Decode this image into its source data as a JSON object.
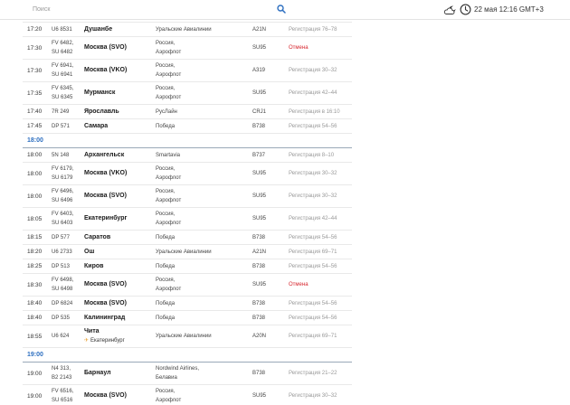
{
  "search": {
    "placeholder": "Поиск"
  },
  "header": {
    "datetime": "22 мая 12:16 GMT+3"
  },
  "board": [
    {
      "type": "flight",
      "time": "17:20",
      "flights": [
        "U6 8531"
      ],
      "dest": "Душанбе",
      "airline": [
        "Уральские Авиалинии"
      ],
      "aircraft": "A21N",
      "status": "Регистрация 76–78",
      "cancelled": false
    },
    {
      "type": "flight",
      "time": "17:30",
      "flights": [
        "FV 6482,",
        "SU 6482"
      ],
      "dest": "Москва (SVO)",
      "airline": [
        "Россия,",
        "Аэрофлот"
      ],
      "aircraft": "SU95",
      "status": "Отмена",
      "cancelled": true
    },
    {
      "type": "flight",
      "time": "17:30",
      "flights": [
        "FV 6941,",
        "SU 6941"
      ],
      "dest": "Москва (VKO)",
      "airline": [
        "Россия,",
        "Аэрофлот"
      ],
      "aircraft": "A319",
      "status": "Регистрация 30–32",
      "cancelled": false
    },
    {
      "type": "flight",
      "time": "17:35",
      "flights": [
        "FV 6345,",
        "SU 6345"
      ],
      "dest": "Мурманск",
      "airline": [
        "Россия,",
        "Аэрофлот"
      ],
      "aircraft": "SU95",
      "status": "Регистрация 42–44",
      "cancelled": false
    },
    {
      "type": "flight",
      "time": "17:40",
      "flights": [
        "7R 249"
      ],
      "dest": "Ярославль",
      "airline": [
        "РусЛайн"
      ],
      "aircraft": "CRJ1",
      "status": "Регистрация в 16:10",
      "cancelled": false
    },
    {
      "type": "flight",
      "time": "17:45",
      "flights": [
        "DP 571"
      ],
      "dest": "Самара",
      "airline": [
        "Победа"
      ],
      "aircraft": "B738",
      "status": "Регистрация 54–56",
      "cancelled": false
    },
    {
      "type": "hour",
      "label": "18:00"
    },
    {
      "type": "flight",
      "time": "18:00",
      "flights": [
        "5N 148"
      ],
      "dest": "Архангельск",
      "airline": [
        "Smartavia"
      ],
      "aircraft": "B737",
      "status": "Регистрация 8–10",
      "cancelled": false
    },
    {
      "type": "flight",
      "time": "18:00",
      "flights": [
        "FV 6179,",
        "SU 6179"
      ],
      "dest": "Москва (VKO)",
      "airline": [
        "Россия,",
        "Аэрофлот"
      ],
      "aircraft": "SU95",
      "status": "Регистрация 30–32",
      "cancelled": false
    },
    {
      "type": "flight",
      "time": "18:00",
      "flights": [
        "FV 6496,",
        "SU 6496"
      ],
      "dest": "Москва (SVO)",
      "airline": [
        "Россия,",
        "Аэрофлот"
      ],
      "aircraft": "SU95",
      "status": "Регистрация 30–32",
      "cancelled": false
    },
    {
      "type": "flight",
      "time": "18:05",
      "flights": [
        "FV 6403,",
        "SU 6403"
      ],
      "dest": "Екатеринбург",
      "airline": [
        "Россия,",
        "Аэрофлот"
      ],
      "aircraft": "SU95",
      "status": "Регистрация 42–44",
      "cancelled": false
    },
    {
      "type": "flight",
      "time": "18:15",
      "flights": [
        "DP 577"
      ],
      "dest": "Саратов",
      "airline": [
        "Победа"
      ],
      "aircraft": "B738",
      "status": "Регистрация 54–56",
      "cancelled": false
    },
    {
      "type": "flight",
      "time": "18:20",
      "flights": [
        "U6 2733"
      ],
      "dest": "Ош",
      "airline": [
        "Уральские Авиалинии"
      ],
      "aircraft": "A21N",
      "status": "Регистрация 69–71",
      "cancelled": false
    },
    {
      "type": "flight",
      "time": "18:25",
      "flights": [
        "DP 513"
      ],
      "dest": "Киров",
      "airline": [
        "Победа"
      ],
      "aircraft": "B738",
      "status": "Регистрация 54–56",
      "cancelled": false
    },
    {
      "type": "flight",
      "time": "18:30",
      "flights": [
        "FV 6498,",
        "SU 6498"
      ],
      "dest": "Москва (SVO)",
      "airline": [
        "Россия,",
        "Аэрофлот"
      ],
      "aircraft": "SU95",
      "status": "Отмена",
      "cancelled": true
    },
    {
      "type": "flight",
      "time": "18:40",
      "flights": [
        "DP 6824"
      ],
      "dest": "Москва (SVO)",
      "airline": [
        "Победа"
      ],
      "aircraft": "B738",
      "status": "Регистрация 54–56",
      "cancelled": false
    },
    {
      "type": "flight",
      "time": "18:40",
      "flights": [
        "DP 535"
      ],
      "dest": "Калининград",
      "airline": [
        "Победа"
      ],
      "aircraft": "B738",
      "status": "Регистрация 54–56",
      "cancelled": false
    },
    {
      "type": "flight",
      "time": "18:55",
      "flights": [
        "U6 624"
      ],
      "dest": "Чита",
      "via": "Екатеринбург",
      "airline": [
        "Уральские Авиалинии"
      ],
      "aircraft": "A20N",
      "status": "Регистрация 69–71",
      "cancelled": false
    },
    {
      "type": "hour",
      "label": "19:00"
    },
    {
      "type": "flight",
      "time": "19:00",
      "flights": [
        "N4 313,",
        "B2 2143"
      ],
      "dest": "Барнаул",
      "airline": [
        "Nordwind Airlines,",
        "Белавиа"
      ],
      "aircraft": "B738",
      "status": "Регистрация 21–22",
      "cancelled": false
    },
    {
      "type": "flight",
      "time": "19:00",
      "flights": [
        "FV 6516,",
        "SU 6516"
      ],
      "dest": "Москва (SVO)",
      "airline": [
        "Россия,",
        "Аэрофлот"
      ],
      "aircraft": "SU95",
      "status": "Регистрация 30–32",
      "cancelled": false
    }
  ]
}
